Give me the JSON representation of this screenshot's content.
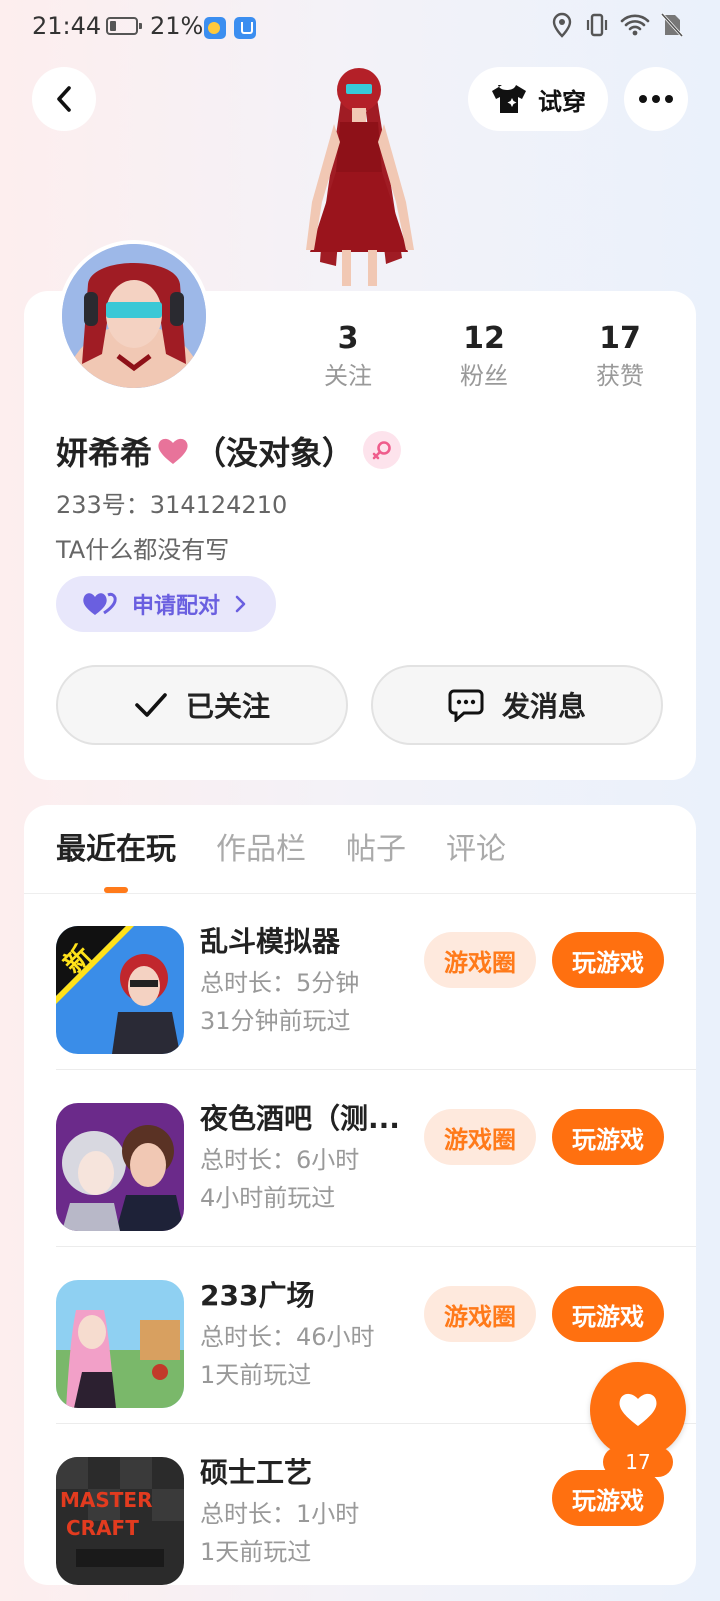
{
  "status_bar": {
    "time": "21:44",
    "battery": "21%"
  },
  "header": {
    "try_on_label": "试穿"
  },
  "profile": {
    "stats": [
      {
        "value": "3",
        "label": "关注"
      },
      {
        "value": "12",
        "label": "粉丝"
      },
      {
        "value": "17",
        "label": "获赞"
      }
    ],
    "name_main": "妍希希",
    "name_suffix": "（没对象）",
    "uid": "233号：314124210",
    "bio": "TA什么都没有写",
    "pair_label": "申请配对",
    "follow_label": "已关注",
    "message_label": "发消息"
  },
  "tabs": [
    "最近在玩",
    "作品栏",
    "帖子",
    "评论"
  ],
  "games": [
    {
      "name": "乱斗模拟器",
      "duration": "总时长：5分钟",
      "last_played": "31分钟前玩过",
      "circle_label": "游戏圈",
      "play_label": "玩游戏"
    },
    {
      "name": "夜色酒吧（测...",
      "duration": "总时长：6小时",
      "last_played": "4小时前玩过",
      "circle_label": "游戏圈",
      "play_label": "玩游戏"
    },
    {
      "name": "233广场",
      "duration": "总时长：46小时",
      "last_played": "1天前玩过",
      "circle_label": "游戏圈",
      "play_label": "玩游戏"
    },
    {
      "name": "硕士工艺",
      "duration": "总时长：1小时",
      "last_played": "1天前玩过",
      "play_label": "玩游戏"
    }
  ],
  "game_icon_labels": {
    "new_badge": "新",
    "craft_logo": [
      "MASTER",
      "CRAFT"
    ]
  },
  "like_fab": {
    "count": "17"
  },
  "colors": {
    "accent": "#ff7010",
    "pair": "#6a5fe0",
    "heart": "#e8739a"
  }
}
